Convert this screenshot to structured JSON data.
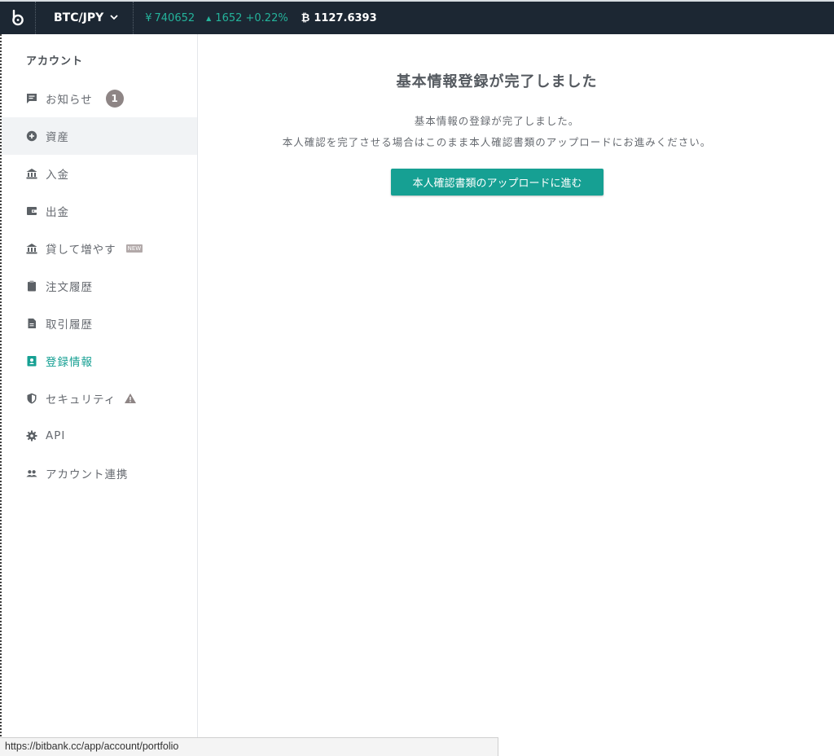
{
  "topbar": {
    "pair": "BTC/JPY",
    "price_symbol": "¥",
    "price": "740652",
    "change": "1652 +0.22%",
    "btc_symbol": "₿",
    "btc_value": "1127.6393",
    "price_color": "#24b39b"
  },
  "sidebar": {
    "title": "アカウント",
    "items": [
      {
        "label": "お知らせ",
        "icon": "message-icon",
        "badge": "1"
      },
      {
        "label": "資産",
        "icon": "asset-icon"
      },
      {
        "label": "入金",
        "icon": "bank-icon"
      },
      {
        "label": "出金",
        "icon": "wallet-icon"
      },
      {
        "label": "貸して増やす",
        "icon": "bank-icon",
        "tag": "NEW"
      },
      {
        "label": "注文履歴",
        "icon": "clipboard-icon"
      },
      {
        "label": "取引履歴",
        "icon": "document-icon"
      },
      {
        "label": "登録情報",
        "icon": "profile-icon"
      },
      {
        "label": "セキュリティ",
        "icon": "shield-icon"
      },
      {
        "label": "API",
        "icon": "gear-icon"
      },
      {
        "label": "アカウント連携",
        "icon": "people-icon"
      }
    ]
  },
  "main": {
    "title": "基本情報登録が完了しました",
    "message1": "基本情報の登録が完了しました。",
    "message2": "本人確認を完了させる場合はこのまま本人確認書類のアップロードにお進みください。",
    "button_label": "本人確認書類のアップロードに進む",
    "accent_color": "#16a093"
  },
  "status_bar": {
    "url": "https://bitbank.cc/app/account/portfolio"
  }
}
